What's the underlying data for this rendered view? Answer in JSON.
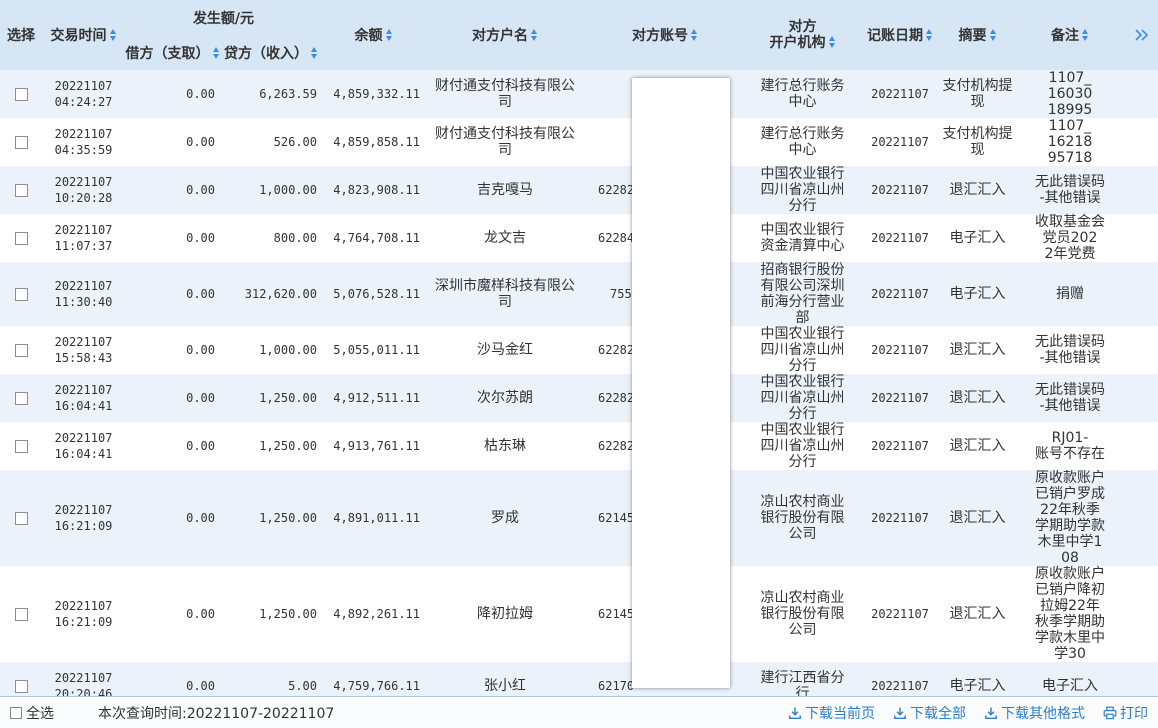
{
  "colors": {
    "header_bg": "#d6e6f5",
    "stripe_bg": "#ebf2fa",
    "accent": "#3a8ee6",
    "link": "#2f7dc8",
    "text": "#333333"
  },
  "header": {
    "select": "选择",
    "time": "交易时间",
    "amount_group": "发生额/元",
    "debit": "借方（支取）",
    "credit": "贷方（收入）",
    "balance": "余额",
    "counterparty_name": "对方户名",
    "counterparty_account": "对方账号",
    "counterparty_bank_line1": "对方",
    "counterparty_bank_line2": "开户机构",
    "posting_date": "记账日期",
    "summary": "摘要",
    "remark": "备注",
    "sort_icon": "sort-arrows-icon",
    "more_columns_icon": "double-chevron-right-icon"
  },
  "rows": [
    {
      "date": "20221107",
      "time": "04:24:27",
      "debit": "0.00",
      "credit": "6,263.59",
      "balance": "4,859,332.11",
      "name": "财付通支付科技有限公司",
      "account": "",
      "bank": "建行总行账务中心",
      "posting_date": "20221107",
      "summary": "支付机构提现",
      "remark": "1107_1603018995"
    },
    {
      "date": "20221107",
      "time": "04:35:59",
      "debit": "0.00",
      "credit": "526.00",
      "balance": "4,859,858.11",
      "name": "财付通支付科技有限公司",
      "account": "",
      "bank": "建行总行账务中心",
      "posting_date": "20221107",
      "summary": "支付机构提现",
      "remark": "1107_1621895718"
    },
    {
      "date": "20221107",
      "time": "10:20:28",
      "debit": "0.00",
      "credit": "1,000.00",
      "balance": "4,823,908.11",
      "name": "吉克嘎马",
      "account": "62282",
      "bank": "中国农业银行四川省凉山州分行",
      "posting_date": "20221107",
      "summary": "退汇汇入",
      "remark": "无此错误码-其他错误"
    },
    {
      "date": "20221107",
      "time": "11:07:37",
      "debit": "0.00",
      "credit": "800.00",
      "balance": "4,764,708.11",
      "name": "龙文吉",
      "account": "62284",
      "bank": "中国农业银行资金清算中心",
      "posting_date": "20221107",
      "summary": "电子汇入",
      "remark": "收取基金会党员2022年党费"
    },
    {
      "date": "20221107",
      "time": "11:30:40",
      "debit": "0.00",
      "credit": "312,620.00",
      "balance": "5,076,528.11",
      "name": "深圳市魔样科技有限公司",
      "account": "755",
      "bank": "招商银行股份有限公司深圳前海分行营业部",
      "posting_date": "20221107",
      "summary": "电子汇入",
      "remark": "捐赠"
    },
    {
      "date": "20221107",
      "time": "15:58:43",
      "debit": "0.00",
      "credit": "1,000.00",
      "balance": "5,055,011.11",
      "name": "沙马金红",
      "account": "62282",
      "bank": "中国农业银行四川省凉山州分行",
      "posting_date": "20221107",
      "summary": "退汇汇入",
      "remark": "无此错误码-其他错误"
    },
    {
      "date": "20221107",
      "time": "16:04:41",
      "debit": "0.00",
      "credit": "1,250.00",
      "balance": "4,912,511.11",
      "name": "次尔苏朗",
      "account": "62282",
      "bank": "中国农业银行四川省凉山州分行",
      "posting_date": "20221107",
      "summary": "退汇汇入",
      "remark": "无此错误码-其他错误"
    },
    {
      "date": "20221107",
      "time": "16:04:41",
      "debit": "0.00",
      "credit": "1,250.00",
      "balance": "4,913,761.11",
      "name": "枯东琳",
      "account": "62282",
      "bank": "中国农业银行四川省凉山州分行",
      "posting_date": "20221107",
      "summary": "退汇汇入",
      "remark": "RJ01-账号不存在"
    },
    {
      "date": "20221107",
      "time": "16:21:09",
      "debit": "0.00",
      "credit": "1,250.00",
      "balance": "4,891,011.11",
      "name": "罗成",
      "account": "62145",
      "bank": "凉山农村商业银行股份有限公司",
      "posting_date": "20221107",
      "summary": "退汇汇入",
      "remark": "原收款账户已销户罗成22年秋季学期助学款木里中学108"
    },
    {
      "date": "20221107",
      "time": "16:21:09",
      "debit": "0.00",
      "credit": "1,250.00",
      "balance": "4,892,261.11",
      "name": "降初拉姆",
      "account": "62145",
      "bank": "凉山农村商业银行股份有限公司",
      "posting_date": "20221107",
      "summary": "退汇汇入",
      "remark": "原收款账户已销户降初拉姆22年秋季学期助学款木里中学30"
    },
    {
      "date": "20221107",
      "time": "20:20:46",
      "debit": "0.00",
      "credit": "5.00",
      "balance": "4,759,766.11",
      "name": "张小红",
      "account": "62170",
      "bank": "建行江西省分行",
      "posting_date": "20221107",
      "summary": "电子汇入",
      "remark": "电子汇入"
    }
  ],
  "footer": {
    "select_all": "全选",
    "query_time": "本次查询时间:20221107-20221107",
    "download_page": "下载当前页",
    "download_all": "下载全部",
    "download_other": "下载其他格式",
    "print": "打印",
    "download_icon": "download-icon",
    "print_icon": "printer-icon"
  }
}
